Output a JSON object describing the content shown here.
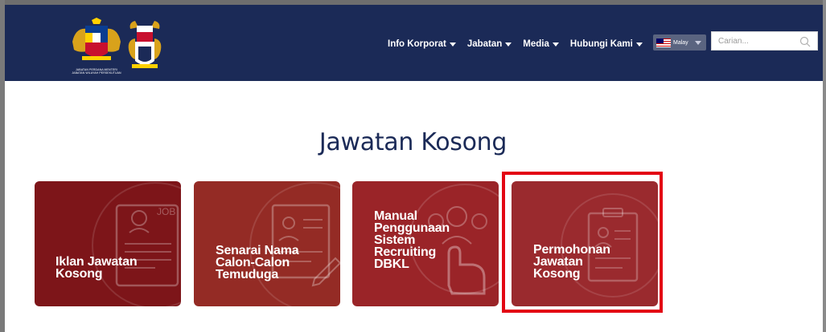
{
  "header": {
    "logo_text": "JABATAN PERDANA MENTERI\nJABATAN WILAYAH PERSEKUTUAN",
    "nav": [
      {
        "label": "Info Korporat"
      },
      {
        "label": "Jabatan"
      },
      {
        "label": "Media"
      },
      {
        "label": "Hubungi Kami"
      }
    ],
    "language": {
      "selected": "Malay",
      "flag_icon": "malaysia-flag-icon"
    },
    "search": {
      "placeholder": "Carian...",
      "value": ""
    }
  },
  "main": {
    "title": "Jawatan Kosong",
    "cards": [
      {
        "label": "Iklan Jawatan\nKosong",
        "icon": "job-resume-icon",
        "color": "#7d1519"
      },
      {
        "label": "Senarai Nama\nCalon-Calon\nTemuduga",
        "icon": "list-edit-icon",
        "color": "#942b25"
      },
      {
        "label": "Manual\nPenggunaan\nSistem\nRecruiting\nDBKL",
        "icon": "user-touch-icon",
        "color": "#9a2428"
      },
      {
        "label": "Permohonan\nJawatan\nKosong",
        "icon": "clipboard-application-icon",
        "color": "#9a2a2e",
        "highlighted": true
      }
    ]
  },
  "colors": {
    "header_bg": "#1b2a57",
    "title_text": "#1b2a57",
    "highlight_border": "#e30613"
  }
}
